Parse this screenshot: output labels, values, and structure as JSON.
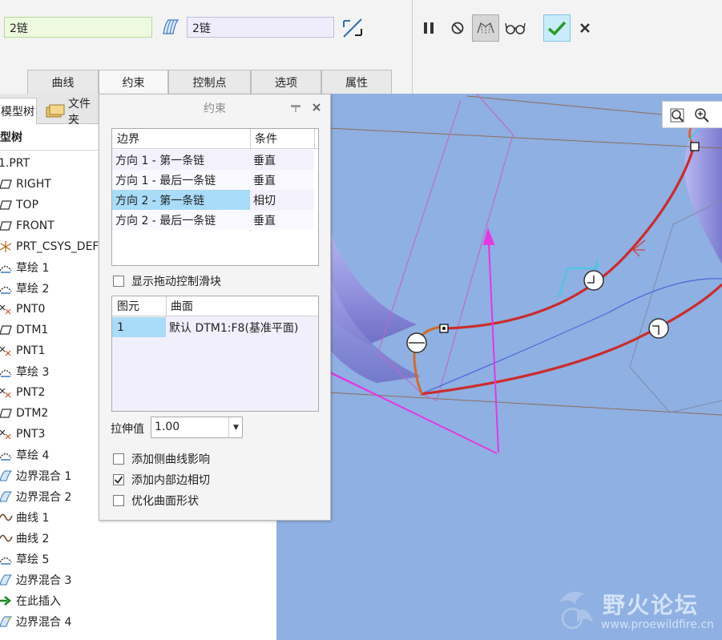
{
  "dashboard": {
    "chain1_value": "2链",
    "chain2_value": "2链",
    "icons": [
      "boundary-surface-icon",
      "flip-arrow-icon",
      "pause-icon",
      "no-preview-icon",
      "geometry-preview-icon",
      "glasses-icon",
      "check-icon",
      "close-icon"
    ],
    "ok_color": "#2a9a2a"
  },
  "tabs": [
    {
      "label": "曲线"
    },
    {
      "label": "约束"
    },
    {
      "label": "控制点"
    },
    {
      "label": "选项"
    },
    {
      "label": "属性"
    }
  ],
  "model_tree": {
    "tab_model": "模型树",
    "tab_file": "文件夹",
    "header": "模型树",
    "items": [
      {
        "label": "1.PRT",
        "icon": "part-icon"
      },
      {
        "label": "RIGHT",
        "icon": "datum-plane-icon"
      },
      {
        "label": "TOP",
        "icon": "datum-plane-icon"
      },
      {
        "label": "FRONT",
        "icon": "datum-plane-icon"
      },
      {
        "label": "PRT_CSYS_DEF",
        "icon": "csys-icon"
      },
      {
        "label": "草绘 1",
        "icon": "sketch-icon"
      },
      {
        "label": "草绘 2",
        "icon": "sketch-icon"
      },
      {
        "label": "PNT0",
        "icon": "datum-point-icon"
      },
      {
        "label": "DTM1",
        "icon": "datum-plane-icon"
      },
      {
        "label": "PNT1",
        "icon": "datum-point-icon"
      },
      {
        "label": "草绘 3",
        "icon": "sketch-icon"
      },
      {
        "label": "PNT2",
        "icon": "datum-point-icon"
      },
      {
        "label": "DTM2",
        "icon": "datum-plane-icon"
      },
      {
        "label": "PNT3",
        "icon": "datum-point-icon"
      },
      {
        "label": "草绘 4",
        "icon": "sketch-icon"
      },
      {
        "label": "边界混合 1",
        "icon": "boundary-blend-icon"
      },
      {
        "label": "边界混合 2",
        "icon": "boundary-blend-icon"
      },
      {
        "label": "曲线 1",
        "icon": "curve-icon"
      },
      {
        "label": "曲线 2",
        "icon": "curve-icon"
      },
      {
        "label": "草绘 5",
        "icon": "sketch-icon"
      },
      {
        "label": "边界混合 3",
        "icon": "boundary-blend-icon"
      },
      {
        "label": "在此插入",
        "icon": "insert-here-arrow-icon"
      },
      {
        "label": "边界混合 4",
        "icon": "boundary-blend-new-icon"
      }
    ]
  },
  "dialog": {
    "title": "约束",
    "boundary_table": {
      "headers": [
        "边界",
        "条件"
      ],
      "rows": [
        {
          "boundary": "方向 1 - 第一条链",
          "condition": "垂直"
        },
        {
          "boundary": "方向 1 - 最后一条链",
          "condition": "垂直"
        },
        {
          "boundary": "方向 2 - 第一条链",
          "condition": "相切",
          "selected": true
        },
        {
          "boundary": "方向 2 - 最后一条链",
          "condition": "垂直"
        }
      ]
    },
    "show_handles_label": "显示拖动控制滑块",
    "show_handles_checked": false,
    "surface_table": {
      "headers": [
        "图元",
        "曲面"
      ],
      "rows": [
        {
          "element": "1",
          "surface": "默认 DTM1:F8(基准平面)"
        }
      ]
    },
    "stretch_label": "拉伸值",
    "stretch_value": "1.00",
    "options": [
      {
        "label": "添加侧曲线影响",
        "checked": false
      },
      {
        "label": "添加内部边相切",
        "checked": true
      },
      {
        "label": "优化曲面形状",
        "checked": false
      }
    ]
  },
  "watermark": {
    "brand": "野火论坛",
    "url": "www.proewildfire.cn"
  }
}
